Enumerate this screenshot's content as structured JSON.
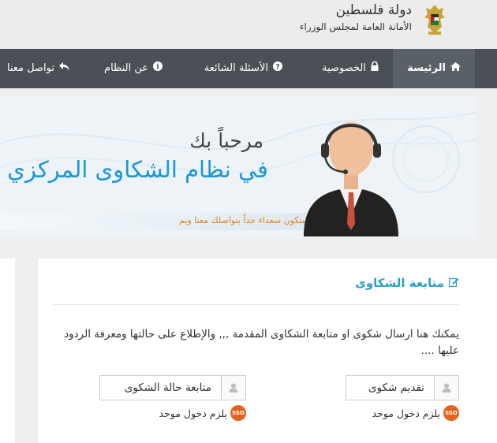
{
  "header": {
    "state_name": "دولة فلسطين",
    "sub_name": "الأمانة العامة لمجلس الوزراء",
    "logo": "palestine-emblem-icon"
  },
  "nav": {
    "items": [
      {
        "label": "الرئيسة",
        "icon": "home-icon",
        "active": true
      },
      {
        "label": "الخصوصية",
        "icon": "lock-icon"
      },
      {
        "label": "الأسئلة الشائعة",
        "icon": "question-circle-icon"
      },
      {
        "label": "عن النظام",
        "icon": "info-circle-icon"
      },
      {
        "label": "تواصل معنا",
        "icon": "reply-icon"
      }
    ]
  },
  "banner": {
    "welcome": "مرحباً بك",
    "system": "في نظام الشكاوى المركزي",
    "ribbon": "سنكون سعداء جداً بتواصلك معنا وبم"
  },
  "card": {
    "title": "متابعة الشكاوى",
    "title_icon": "edit-icon",
    "description": "يمكنك هنا ارسال شكوى او متابعة الشكاوى المقدمة ,,, والإطلاع على حالتها ومعرفة الردود عليها ....",
    "submit_label": "تقديم شكوى",
    "track_label": "متابعة حالة الشكوى",
    "login_note": "يلزم دخول موحد",
    "sso_text": "SSO"
  },
  "colors": {
    "nav_bg": "#4b5056",
    "accent": "#1a98d5",
    "title": "#2aa3c3",
    "sso": "#e2621f"
  }
}
